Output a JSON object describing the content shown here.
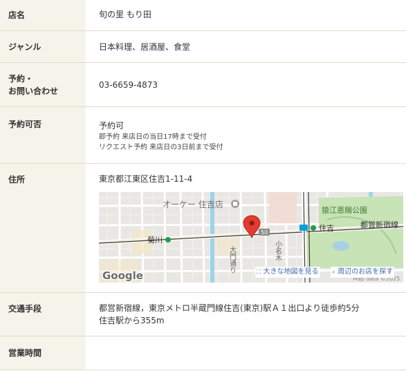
{
  "rows": [
    {
      "label": "店名",
      "value": "旬の里 もり田"
    },
    {
      "label": "ジャンル",
      "value": "日本料理、居酒屋、食堂"
    },
    {
      "label_lines": [
        "予約・",
        "お問い合わせ"
      ],
      "value": "03-6659-4873"
    },
    {
      "label": "予約可否",
      "value": "予約可",
      "notes": [
        "即予約 来店日の当日17時まで受付",
        "リクエスト予約 来店日の3日前まで受付"
      ]
    },
    {
      "label": "住所",
      "value": "東京都江東区住吉1-11-4"
    },
    {
      "label": "交通手段",
      "value_lines": [
        "都営新宿線，東京メトロ半蔵門線住吉(東京)駅Ａ１出口より徒歩約5分",
        "住吉駅から355m"
      ]
    },
    {
      "label": "営業時間",
      "value": ""
    }
  ],
  "map": {
    "labels": {
      "store": "オーケー 住吉店",
      "park": "猿江恩賜公園",
      "station_kikukawa": "菊川",
      "station_sumiyoshi": "住吉",
      "line": "都営新宿線",
      "street": "大門通り",
      "street2": "小名木",
      "road_number": "50",
      "google": "Google",
      "map_data": "Map data ©2025"
    },
    "links": {
      "large_map": "大きな地図を見る",
      "nearby": "周辺のお店を探す"
    },
    "colors": {
      "pin": "#e23b30",
      "park": "#c8e3b6",
      "station_icon": "#1a9e4b"
    }
  }
}
